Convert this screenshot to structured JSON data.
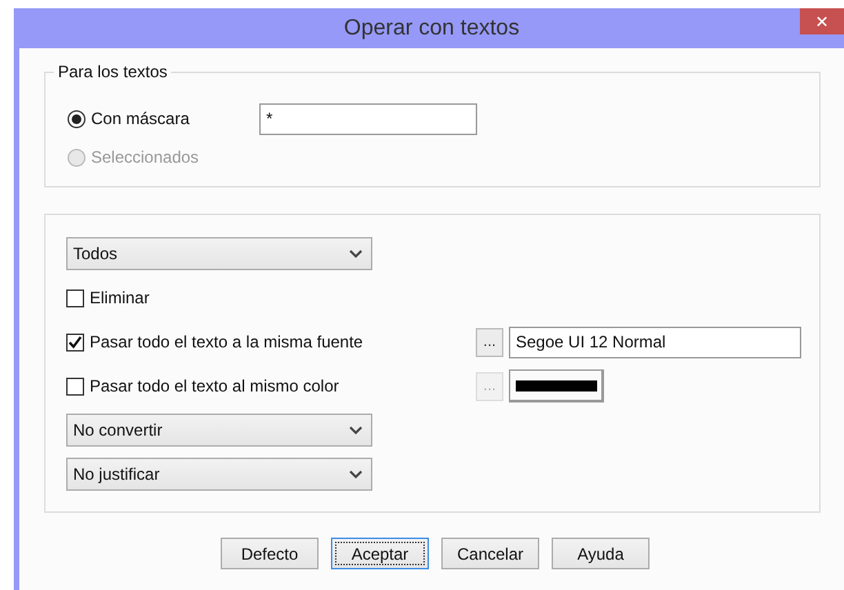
{
  "window": {
    "title": "Operar con textos",
    "close_glyph": "✕"
  },
  "target_group": {
    "legend": "Para los textos",
    "mask": {
      "value": "*"
    },
    "options": [
      {
        "label": "Con máscara",
        "selected": true,
        "disabled": false
      },
      {
        "label": "Seleccionados",
        "selected": false,
        "disabled": true
      }
    ]
  },
  "options_group": {
    "rows": [
      {
        "kind": "combo",
        "value": "Todos"
      },
      {
        "kind": "checkbox",
        "label": "Eliminar",
        "checked": false
      },
      {
        "kind": "checkbox",
        "label": "Pasar todo el texto a la misma fuente",
        "checked": true,
        "picker": {
          "label": "...",
          "disabled": false
        },
        "field": {
          "value": "Segoe UI 12 Normal"
        }
      },
      {
        "kind": "checkbox",
        "label": "Pasar todo el texto al mismo color",
        "checked": false,
        "picker": {
          "label": "...",
          "disabled": true
        },
        "swatch": {
          "color": "#000000"
        }
      },
      {
        "kind": "combo",
        "value": "No convertir"
      },
      {
        "kind": "combo",
        "value": "No justificar"
      }
    ]
  },
  "buttons": [
    {
      "label": "Defecto",
      "focused": false
    },
    {
      "label": "Aceptar",
      "focused": true
    },
    {
      "label": "Cancelar",
      "focused": false
    },
    {
      "label": "Ayuda",
      "focused": false
    }
  ]
}
